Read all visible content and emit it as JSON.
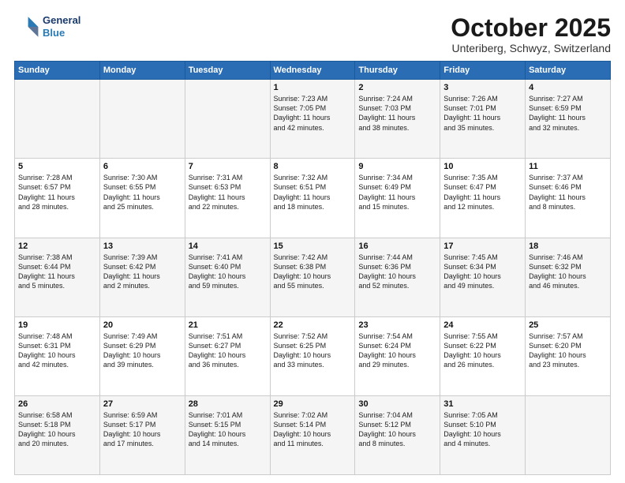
{
  "header": {
    "logo_line1": "General",
    "logo_line2": "Blue",
    "title": "October 2025",
    "subtitle": "Unteriberg, Schwyz, Switzerland"
  },
  "days_of_week": [
    "Sunday",
    "Monday",
    "Tuesday",
    "Wednesday",
    "Thursday",
    "Friday",
    "Saturday"
  ],
  "weeks": [
    [
      {
        "day": "",
        "content": ""
      },
      {
        "day": "",
        "content": ""
      },
      {
        "day": "",
        "content": ""
      },
      {
        "day": "1",
        "content": "Sunrise: 7:23 AM\nSunset: 7:05 PM\nDaylight: 11 hours\nand 42 minutes."
      },
      {
        "day": "2",
        "content": "Sunrise: 7:24 AM\nSunset: 7:03 PM\nDaylight: 11 hours\nand 38 minutes."
      },
      {
        "day": "3",
        "content": "Sunrise: 7:26 AM\nSunset: 7:01 PM\nDaylight: 11 hours\nand 35 minutes."
      },
      {
        "day": "4",
        "content": "Sunrise: 7:27 AM\nSunset: 6:59 PM\nDaylight: 11 hours\nand 32 minutes."
      }
    ],
    [
      {
        "day": "5",
        "content": "Sunrise: 7:28 AM\nSunset: 6:57 PM\nDaylight: 11 hours\nand 28 minutes."
      },
      {
        "day": "6",
        "content": "Sunrise: 7:30 AM\nSunset: 6:55 PM\nDaylight: 11 hours\nand 25 minutes."
      },
      {
        "day": "7",
        "content": "Sunrise: 7:31 AM\nSunset: 6:53 PM\nDaylight: 11 hours\nand 22 minutes."
      },
      {
        "day": "8",
        "content": "Sunrise: 7:32 AM\nSunset: 6:51 PM\nDaylight: 11 hours\nand 18 minutes."
      },
      {
        "day": "9",
        "content": "Sunrise: 7:34 AM\nSunset: 6:49 PM\nDaylight: 11 hours\nand 15 minutes."
      },
      {
        "day": "10",
        "content": "Sunrise: 7:35 AM\nSunset: 6:47 PM\nDaylight: 11 hours\nand 12 minutes."
      },
      {
        "day": "11",
        "content": "Sunrise: 7:37 AM\nSunset: 6:46 PM\nDaylight: 11 hours\nand 8 minutes."
      }
    ],
    [
      {
        "day": "12",
        "content": "Sunrise: 7:38 AM\nSunset: 6:44 PM\nDaylight: 11 hours\nand 5 minutes."
      },
      {
        "day": "13",
        "content": "Sunrise: 7:39 AM\nSunset: 6:42 PM\nDaylight: 11 hours\nand 2 minutes."
      },
      {
        "day": "14",
        "content": "Sunrise: 7:41 AM\nSunset: 6:40 PM\nDaylight: 10 hours\nand 59 minutes."
      },
      {
        "day": "15",
        "content": "Sunrise: 7:42 AM\nSunset: 6:38 PM\nDaylight: 10 hours\nand 55 minutes."
      },
      {
        "day": "16",
        "content": "Sunrise: 7:44 AM\nSunset: 6:36 PM\nDaylight: 10 hours\nand 52 minutes."
      },
      {
        "day": "17",
        "content": "Sunrise: 7:45 AM\nSunset: 6:34 PM\nDaylight: 10 hours\nand 49 minutes."
      },
      {
        "day": "18",
        "content": "Sunrise: 7:46 AM\nSunset: 6:32 PM\nDaylight: 10 hours\nand 46 minutes."
      }
    ],
    [
      {
        "day": "19",
        "content": "Sunrise: 7:48 AM\nSunset: 6:31 PM\nDaylight: 10 hours\nand 42 minutes."
      },
      {
        "day": "20",
        "content": "Sunrise: 7:49 AM\nSunset: 6:29 PM\nDaylight: 10 hours\nand 39 minutes."
      },
      {
        "day": "21",
        "content": "Sunrise: 7:51 AM\nSunset: 6:27 PM\nDaylight: 10 hours\nand 36 minutes."
      },
      {
        "day": "22",
        "content": "Sunrise: 7:52 AM\nSunset: 6:25 PM\nDaylight: 10 hours\nand 33 minutes."
      },
      {
        "day": "23",
        "content": "Sunrise: 7:54 AM\nSunset: 6:24 PM\nDaylight: 10 hours\nand 29 minutes."
      },
      {
        "day": "24",
        "content": "Sunrise: 7:55 AM\nSunset: 6:22 PM\nDaylight: 10 hours\nand 26 minutes."
      },
      {
        "day": "25",
        "content": "Sunrise: 7:57 AM\nSunset: 6:20 PM\nDaylight: 10 hours\nand 23 minutes."
      }
    ],
    [
      {
        "day": "26",
        "content": "Sunrise: 6:58 AM\nSunset: 5:18 PM\nDaylight: 10 hours\nand 20 minutes."
      },
      {
        "day": "27",
        "content": "Sunrise: 6:59 AM\nSunset: 5:17 PM\nDaylight: 10 hours\nand 17 minutes."
      },
      {
        "day": "28",
        "content": "Sunrise: 7:01 AM\nSunset: 5:15 PM\nDaylight: 10 hours\nand 14 minutes."
      },
      {
        "day": "29",
        "content": "Sunrise: 7:02 AM\nSunset: 5:14 PM\nDaylight: 10 hours\nand 11 minutes."
      },
      {
        "day": "30",
        "content": "Sunrise: 7:04 AM\nSunset: 5:12 PM\nDaylight: 10 hours\nand 8 minutes."
      },
      {
        "day": "31",
        "content": "Sunrise: 7:05 AM\nSunset: 5:10 PM\nDaylight: 10 hours\nand 4 minutes."
      },
      {
        "day": "",
        "content": ""
      }
    ]
  ]
}
